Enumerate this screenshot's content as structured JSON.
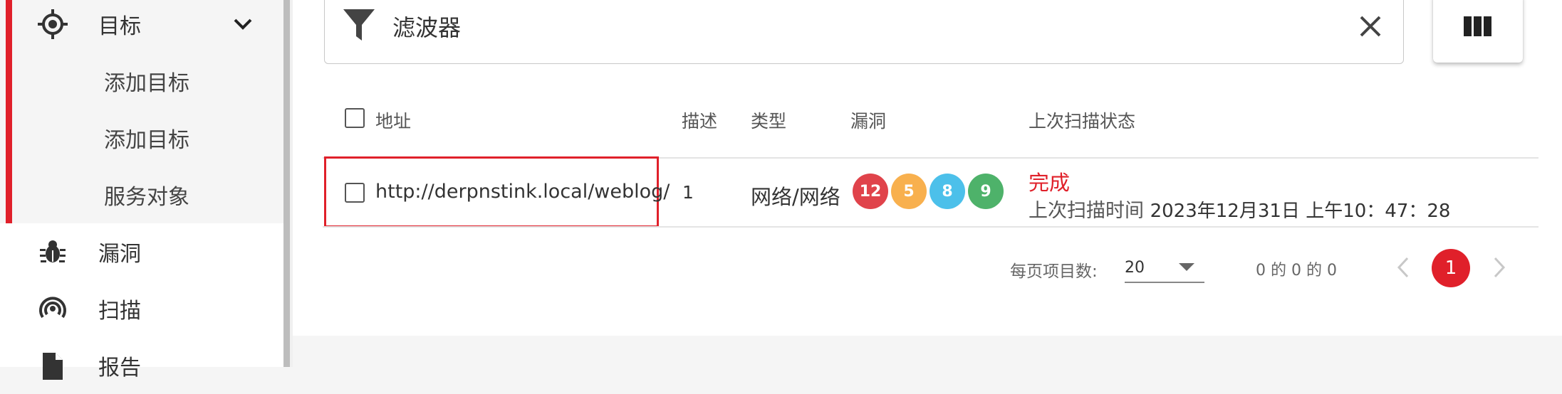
{
  "sidebar": {
    "targets": {
      "label": "目标",
      "icon": "crosshair-icon"
    },
    "sub_items": [
      {
        "label": "添加目标"
      },
      {
        "label": "添加目标"
      },
      {
        "label": "服务对象"
      }
    ],
    "items": [
      {
        "label": "漏洞",
        "icon": "bug-icon"
      },
      {
        "label": "扫描",
        "icon": "radar-icon"
      },
      {
        "label": "报告",
        "icon": "file-icon"
      }
    ]
  },
  "filter": {
    "placeholder": "滤波器"
  },
  "table": {
    "headers": {
      "address": "地址",
      "description": "描述",
      "type": "类型",
      "vulnerabilities": "漏洞",
      "last_scan_status": "上次扫描状态"
    },
    "rows": [
      {
        "address": "http://derpnstink.local/weblog/",
        "description": "1",
        "type": "网络/网络",
        "vulns": {
          "critical": "12",
          "high": "5",
          "medium": "8",
          "low": "9"
        },
        "status": "完成",
        "last_scan_label": "上次扫描时间",
        "last_scan_time": "2023年12月31日 上午10：47：28"
      }
    ]
  },
  "pagination": {
    "items_per_page_label": "每页项目数:",
    "items_per_page": "20",
    "range": "0 的 0 的 0",
    "current_page": "1"
  },
  "colors": {
    "accent": "#e0202a",
    "vuln_critical": "#e0434b",
    "vuln_high": "#f8b04e",
    "vuln_medium": "#4cc0ea",
    "vuln_low": "#4eb26a"
  }
}
